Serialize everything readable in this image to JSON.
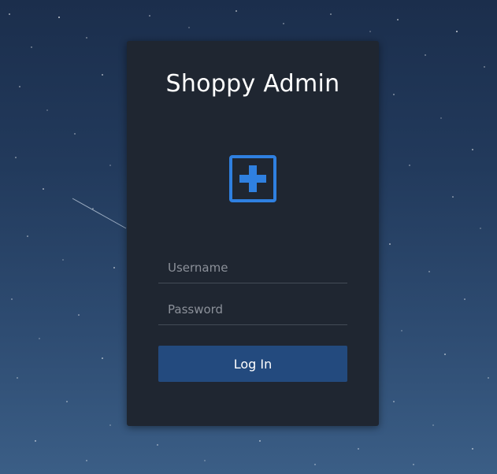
{
  "login": {
    "title": "Shoppy Admin",
    "logo_icon": "plus-square-icon",
    "username_placeholder": "Username",
    "password_placeholder": "Password",
    "login_label": "Log In"
  },
  "colors": {
    "accent": "#2f80e0",
    "button": "#234a7e",
    "card": "#1f2631"
  }
}
